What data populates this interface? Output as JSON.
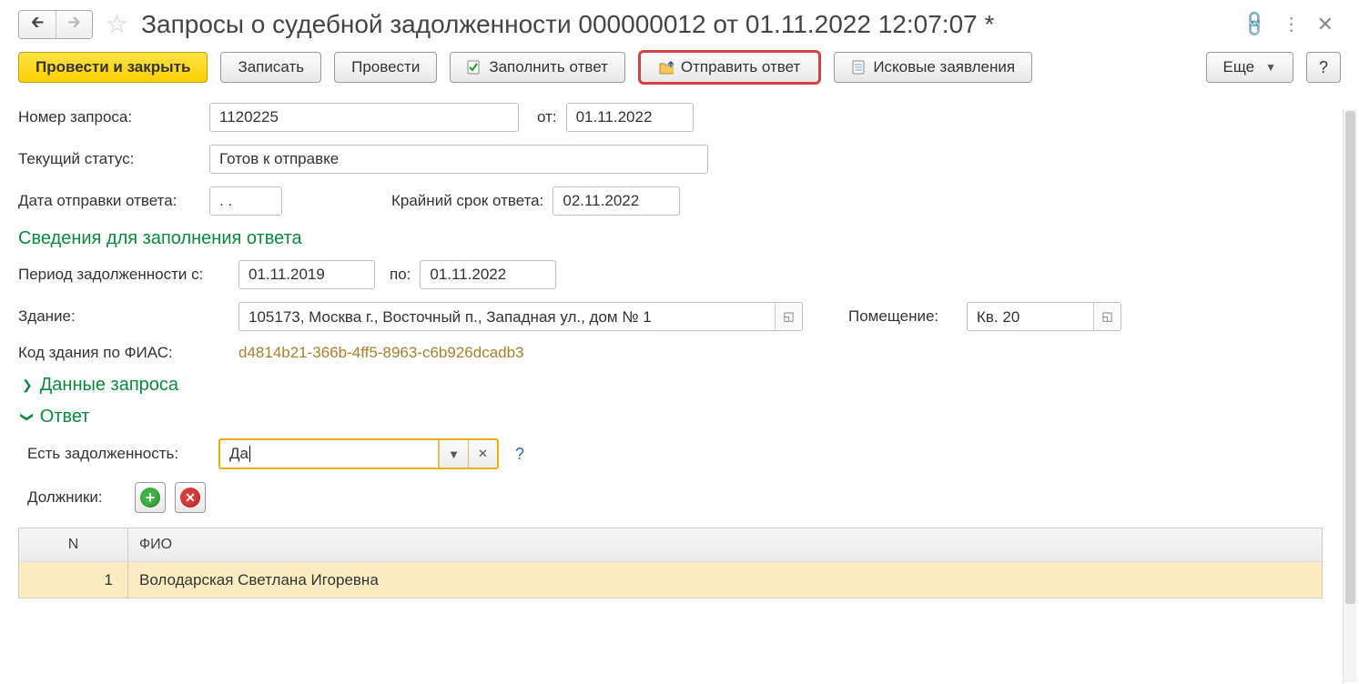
{
  "header": {
    "title": "Запросы о судебной задолженности 000000012 от 01.11.2022 12:07:07 *"
  },
  "toolbar": {
    "post_and_close": "Провести и закрыть",
    "save": "Записать",
    "post": "Провести",
    "fill_answer": "Заполнить ответ",
    "send_answer": "Отправить ответ",
    "claims": "Исковые заявления",
    "more": "Еще",
    "help": "?"
  },
  "form": {
    "request_number_label": "Номер запроса:",
    "request_number": "1120225",
    "from_label": "от:",
    "from_date": "01.11.2022",
    "status_label": "Текущий статус:",
    "status": "Готов к отправке",
    "send_date_label": "Дата отправки ответа:",
    "send_date": ".  .",
    "deadline_label": "Крайний срок ответа:",
    "deadline": "02.11.2022",
    "section_answer_info": "Сведения для заполнения ответа",
    "debt_period_from_label": "Период задолженности с:",
    "debt_period_from": "01.11.2019",
    "debt_period_to_label": "по:",
    "debt_period_to": "01.11.2022",
    "building_label": "Здание:",
    "building": "105173, Москва г., Восточный п., Западная ул., дом № 1",
    "room_label": "Помещение:",
    "room": "Кв. 20",
    "fias_label": "Код здания по ФИАС:",
    "fias": "d4814b21-366b-4ff5-8963-c6b926dcadb3",
    "section_request_data": "Данные запроса",
    "section_answer": "Ответ",
    "has_debt_label": "Есть задолженность:",
    "has_debt_value": "Да",
    "debtors_label": "Должники:"
  },
  "table": {
    "headers": {
      "n": "N",
      "fio": "ФИО"
    },
    "rows": [
      {
        "n": "1",
        "fio": "Володарская Светлана Игоревна"
      }
    ]
  }
}
